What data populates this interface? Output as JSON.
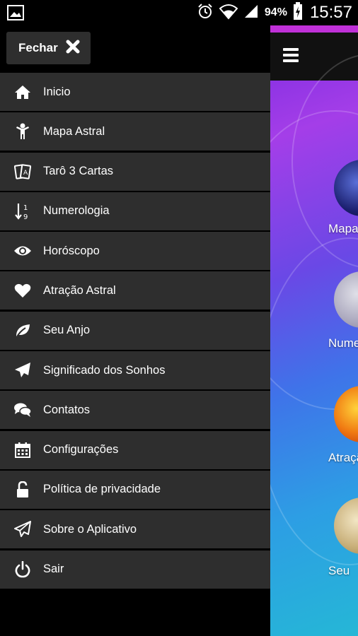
{
  "status_bar": {
    "battery": "94%",
    "time": "15:57"
  },
  "drawer": {
    "close_label": "Fechar",
    "items": [
      {
        "label": "Inicio",
        "icon": "home-icon"
      },
      {
        "label": "Mapa Astral",
        "icon": "person-icon"
      },
      {
        "label": "Tarô 3 Cartas",
        "icon": "cards-icon"
      },
      {
        "label": "Numerologia",
        "icon": "sort-numeric-icon"
      },
      {
        "label": "Horóscopo",
        "icon": "eye-icon"
      },
      {
        "label": "Atração Astral",
        "icon": "heart-icon"
      },
      {
        "label": "Seu Anjo",
        "icon": "leaf-icon"
      },
      {
        "label": "Significado dos Sonhos",
        "icon": "paper-plane-icon"
      },
      {
        "label": "Contatos",
        "icon": "chat-icon"
      },
      {
        "label": "Configurações",
        "icon": "calendar-icon"
      },
      {
        "label": "Política de privacidade",
        "icon": "unlock-icon"
      },
      {
        "label": "Sobre o Aplicativo",
        "icon": "paper-plane-outline-icon"
      },
      {
        "label": "Sair",
        "icon": "power-icon"
      }
    ]
  },
  "background_app": {
    "labels": [
      "Mapa",
      "Nume",
      "Atraçã",
      "Seu"
    ]
  },
  "colors": {
    "drawer_item_bg": "#2e2e2e",
    "background": "#000000",
    "app_gradient_top": "#a43ee8",
    "app_gradient_bottom": "#25b7d6"
  }
}
